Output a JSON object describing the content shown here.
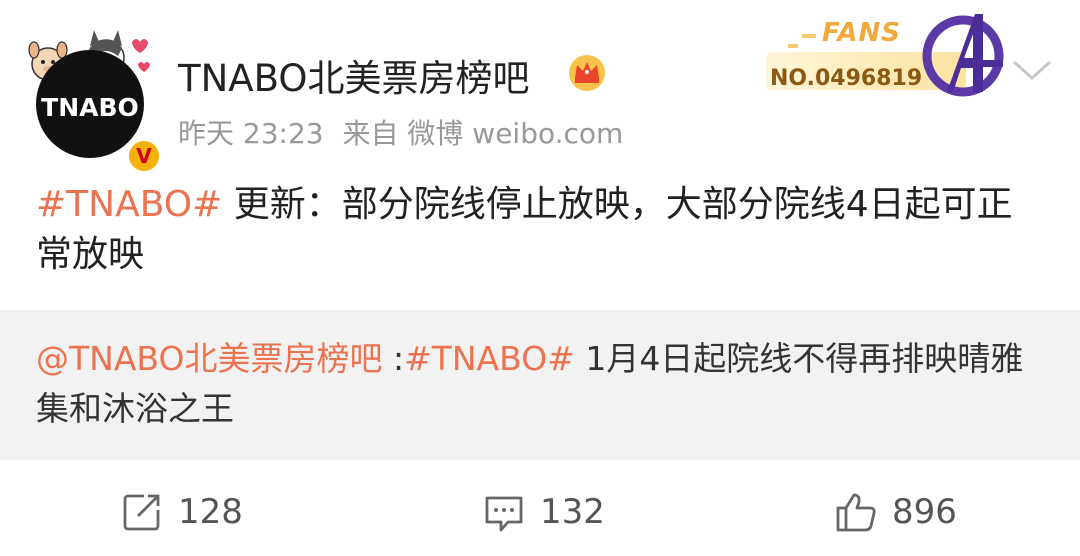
{
  "header": {
    "avatar_text": "TNABO",
    "user_name": "TNABO北美票房榜吧",
    "time": "昨天 23:23",
    "source": "来自 微博 weibo.com",
    "verified_mark": "V",
    "fans_badge": {
      "label": "FANS",
      "number": "NO.0496819"
    }
  },
  "post": {
    "hashtag": "#TNABO#",
    "text": " 更新：部分院线停止放映，大部分院线4日起可正常放映"
  },
  "repost": {
    "mention": "@TNABO北美票房榜吧",
    "separator": " :",
    "hashtag": "#TNABO#",
    "text": " 1月4日起院线不得再排映晴雅集和沐浴之王"
  },
  "actions": {
    "repost_count": "128",
    "comment_count": "132",
    "like_count": "896"
  },
  "colors": {
    "accent": "#eb7350",
    "badge_gold": "#f6b20a",
    "repost_bg": "#f2f2f2"
  },
  "icons": [
    "crown-icon",
    "verified-icon",
    "chevron-down-icon",
    "repost-icon",
    "comment-icon",
    "like-icon",
    "avengers-logo-icon"
  ]
}
